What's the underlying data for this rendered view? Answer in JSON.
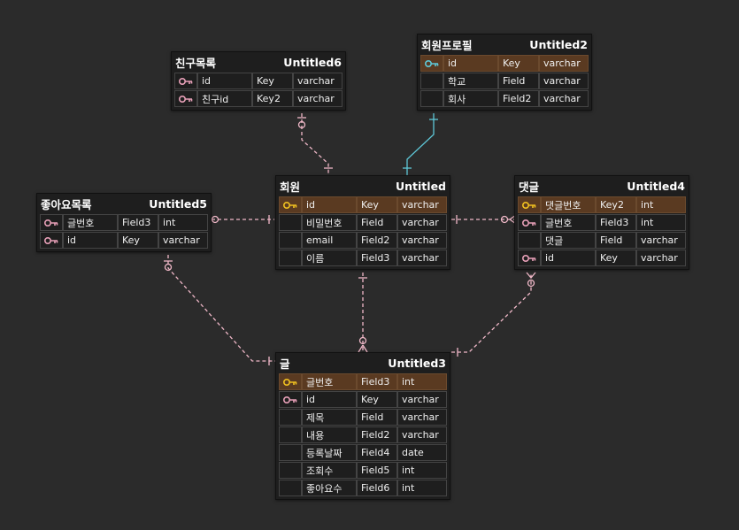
{
  "colors": {
    "background": "#2b2b2b",
    "table_bg": "#1e1e1e",
    "pk_row": "#5a3a21",
    "relation_line": "#f0b8c8",
    "highlight_line": "#5ec8d8",
    "key_icon_pk": "#f0c020",
    "key_icon_fk": "#e8a0b8",
    "key_icon_highlight": "#5ec8d8"
  },
  "tables": [
    {
      "id": "friends",
      "name": "친구목록",
      "logical": "Untitled6",
      "rows": [
        {
          "icon": "fk-key-icon",
          "name": "id",
          "key": "Key",
          "type": "varchar"
        },
        {
          "icon": "fk-key-icon",
          "name": "친구id",
          "key": "Key2",
          "type": "varchar"
        }
      ]
    },
    {
      "id": "profile",
      "name": "회원프로필",
      "logical": "Untitled2",
      "rows": [
        {
          "icon": "highlight-key-icon",
          "name": "id",
          "key": "Key",
          "type": "varchar",
          "pk": true
        },
        {
          "icon": "",
          "name": "학교",
          "key": "Field",
          "type": "varchar"
        },
        {
          "icon": "",
          "name": "회사",
          "key": "Field2",
          "type": "varchar"
        }
      ]
    },
    {
      "id": "likes",
      "name": "좋아요목록",
      "logical": "Untitled5",
      "rows": [
        {
          "icon": "fk-key-icon",
          "name": "글번호",
          "key": "Field3",
          "type": "int"
        },
        {
          "icon": "fk-key-icon",
          "name": "id",
          "key": "Key",
          "type": "varchar"
        }
      ]
    },
    {
      "id": "member",
      "name": "회원",
      "logical": "Untitled",
      "rows": [
        {
          "icon": "pk-key-icon",
          "name": "id",
          "key": "Key",
          "type": "varchar",
          "pk": true
        },
        {
          "icon": "",
          "name": "비밀번호",
          "key": "Field",
          "type": "varchar"
        },
        {
          "icon": "",
          "name": "email",
          "key": "Field2",
          "type": "varchar"
        },
        {
          "icon": "",
          "name": "이름",
          "key": "Field3",
          "type": "varchar"
        }
      ]
    },
    {
      "id": "comment",
      "name": "댓글",
      "logical": "Untitled4",
      "rows": [
        {
          "icon": "pk-key-icon",
          "name": "댓글번호",
          "key": "Key2",
          "type": "int",
          "pk": true
        },
        {
          "icon": "fk-key-icon",
          "name": "글번호",
          "key": "Field3",
          "type": "int"
        },
        {
          "icon": "",
          "name": "댓글",
          "key": "Field",
          "type": "varchar"
        },
        {
          "icon": "fk-key-icon",
          "name": "id",
          "key": "Key",
          "type": "varchar"
        }
      ]
    },
    {
      "id": "post",
      "name": "글",
      "logical": "Untitled3",
      "rows": [
        {
          "icon": "pk-key-icon",
          "name": "글번호",
          "key": "Field3",
          "type": "int",
          "pk": true
        },
        {
          "icon": "fk-key-icon",
          "name": "id",
          "key": "Key",
          "type": "varchar"
        },
        {
          "icon": "",
          "name": "제목",
          "key": "Field",
          "type": "varchar"
        },
        {
          "icon": "",
          "name": "내용",
          "key": "Field2",
          "type": "varchar"
        },
        {
          "icon": "",
          "name": "등록날짜",
          "key": "Field4",
          "type": "date"
        },
        {
          "icon": "",
          "name": "조회수",
          "key": "Field5",
          "type": "int"
        },
        {
          "icon": "",
          "name": "좋아요수",
          "key": "Field6",
          "type": "int"
        }
      ]
    }
  ]
}
